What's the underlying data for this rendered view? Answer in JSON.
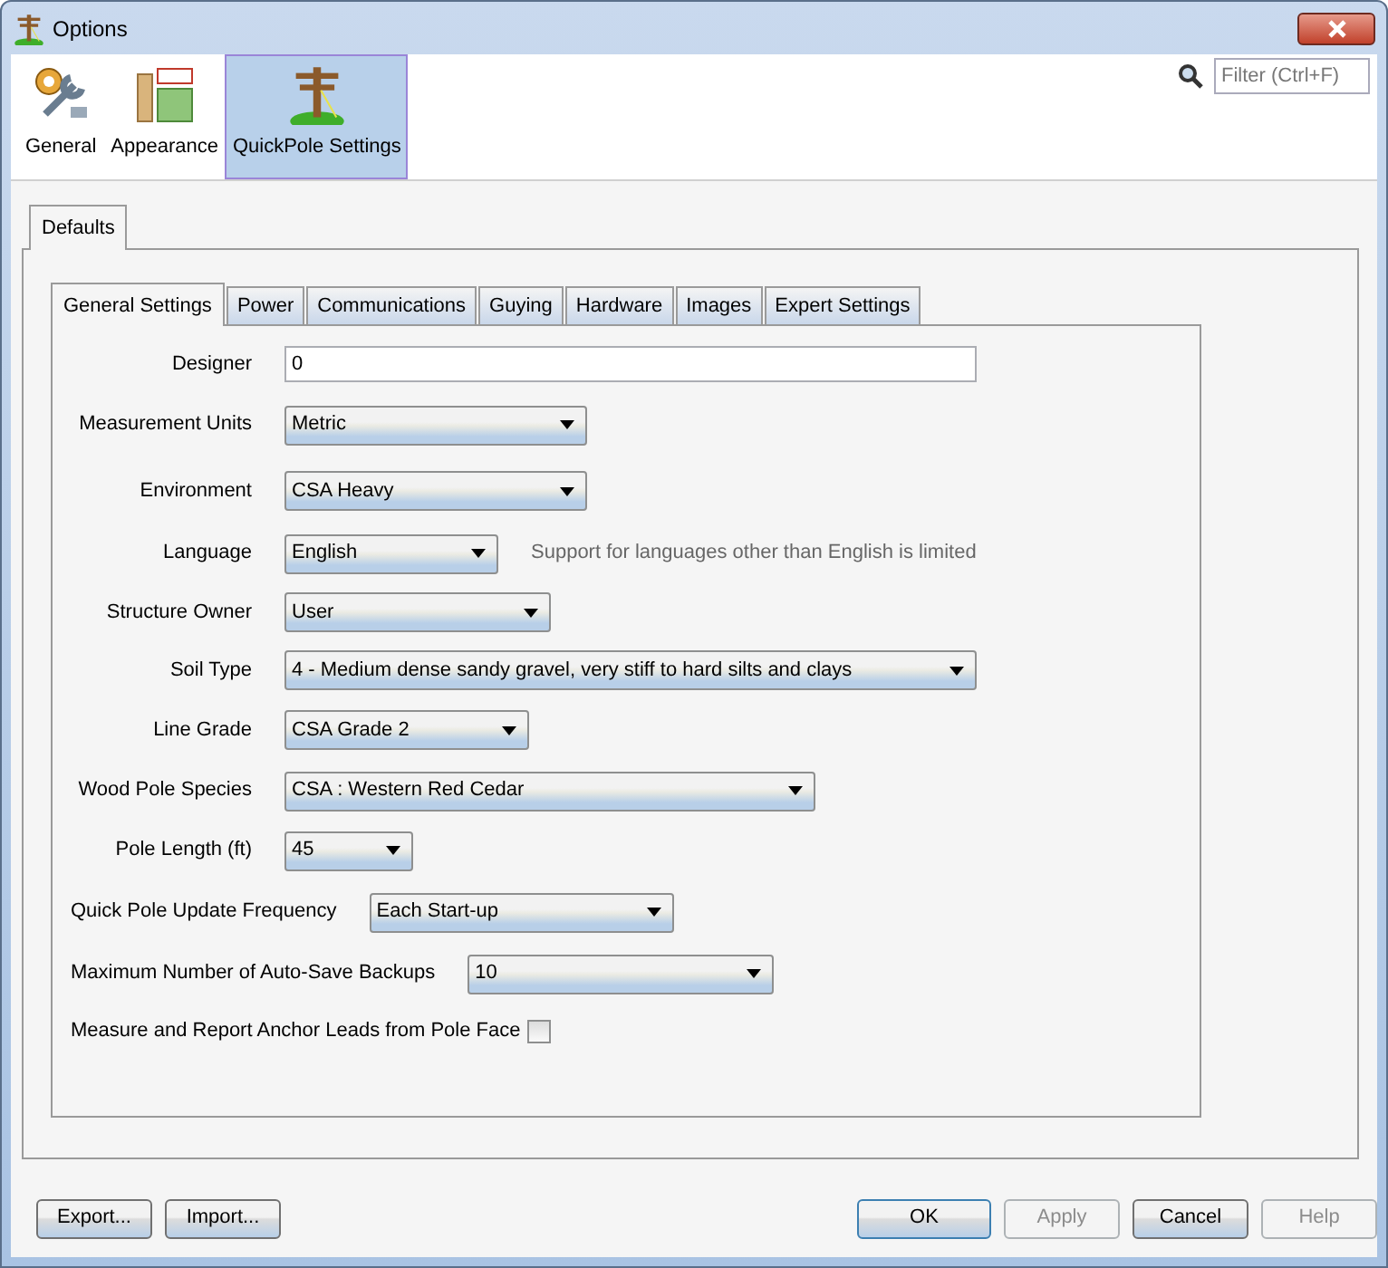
{
  "window": {
    "title": "Options"
  },
  "categories": [
    {
      "label": "General",
      "selected": false
    },
    {
      "label": "Appearance",
      "selected": false
    },
    {
      "label": "QuickPole Settings",
      "selected": true
    }
  ],
  "filter": {
    "placeholder": "Filter (Ctrl+F)"
  },
  "outer_tabs": [
    {
      "label": "Defaults",
      "selected": true
    }
  ],
  "tabs": [
    {
      "label": "General Settings",
      "selected": true
    },
    {
      "label": "Power",
      "selected": false
    },
    {
      "label": "Communications",
      "selected": false
    },
    {
      "label": "Guying",
      "selected": false
    },
    {
      "label": "Hardware",
      "selected": false
    },
    {
      "label": "Images",
      "selected": false
    },
    {
      "label": "Expert Settings",
      "selected": false
    }
  ],
  "fields": [
    {
      "kind": "text",
      "label": "Designer",
      "value": "0"
    },
    {
      "kind": "select",
      "label": "Measurement Units",
      "value": "Metric"
    },
    {
      "kind": "select",
      "label": "Environment",
      "value": "CSA Heavy"
    },
    {
      "kind": "select",
      "label": "Language",
      "value": "English",
      "note": "Support for languages other than English is limited"
    },
    {
      "kind": "select",
      "label": "Structure Owner",
      "value": "User"
    },
    {
      "kind": "select",
      "label": "Soil Type",
      "value": "4 - Medium dense sandy gravel, very stiff to hard silts and clays"
    },
    {
      "kind": "select",
      "label": "Line Grade",
      "value": "CSA Grade 2"
    },
    {
      "kind": "select",
      "label": "Wood Pole Species",
      "value": "CSA : Western Red Cedar"
    },
    {
      "kind": "select",
      "label": "Pole Length (ft)",
      "value": "45"
    },
    {
      "kind": "inline-select",
      "label": "Quick Pole Update Frequency",
      "value": "Each Start-up"
    },
    {
      "kind": "inline-select",
      "label": "Maximum Number of Auto-Save Backups",
      "value": "10"
    },
    {
      "kind": "checkbox",
      "label": "Measure and Report Anchor Leads from Pole Face",
      "checked": false
    }
  ],
  "left_buttons": [
    {
      "label": "Export...",
      "disabled": false
    },
    {
      "label": "Import...",
      "disabled": false
    }
  ],
  "right_buttons": [
    {
      "label": "OK",
      "disabled": false,
      "default": true
    },
    {
      "label": "Apply",
      "disabled": true,
      "default": false
    },
    {
      "label": "Cancel",
      "disabled": false,
      "default": false
    },
    {
      "label": "Help",
      "disabled": true,
      "default": false
    }
  ]
}
